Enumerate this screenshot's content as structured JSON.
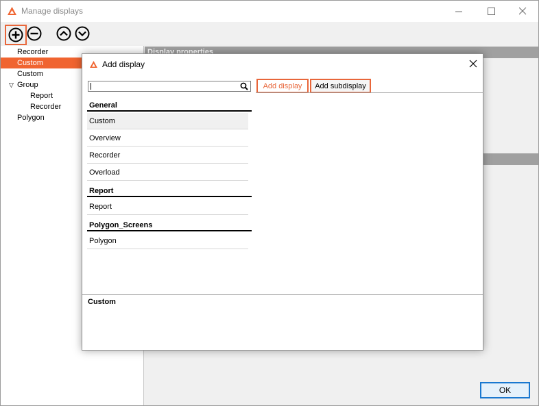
{
  "window": {
    "title": "Manage displays",
    "accent_color": "#f06430"
  },
  "toolbar": {
    "add_icon": "plus-circle-icon",
    "remove_icon": "minus-circle-icon",
    "up_icon": "chevron-up-circle-icon",
    "down_icon": "chevron-down-circle-icon"
  },
  "tree": {
    "items": [
      {
        "label": "Recorder"
      },
      {
        "label": "Custom",
        "selected": true
      },
      {
        "label": "Custom"
      },
      {
        "label": "Group",
        "expanded": true
      },
      {
        "label": "Report"
      },
      {
        "label": "Recorder"
      },
      {
        "label": "Polygon"
      }
    ],
    "toggle_glyph": "▽"
  },
  "right_pane": {
    "section_header": "Display properties",
    "ok_label": "OK"
  },
  "dialog": {
    "title": "Add display",
    "search": {
      "value": "",
      "placeholder": ""
    },
    "tabs": [
      {
        "label": "Add display",
        "active": true
      },
      {
        "label": "Add subdisplay",
        "active": false
      }
    ],
    "groups": [
      {
        "title": "General",
        "items": [
          "Custom",
          "Overview",
          "Recorder",
          "Overload"
        ]
      },
      {
        "title": "Report",
        "items": [
          "Report"
        ]
      },
      {
        "title": "Polygon_Screens",
        "items": [
          "Polygon"
        ]
      }
    ],
    "description_title": "Custom"
  }
}
